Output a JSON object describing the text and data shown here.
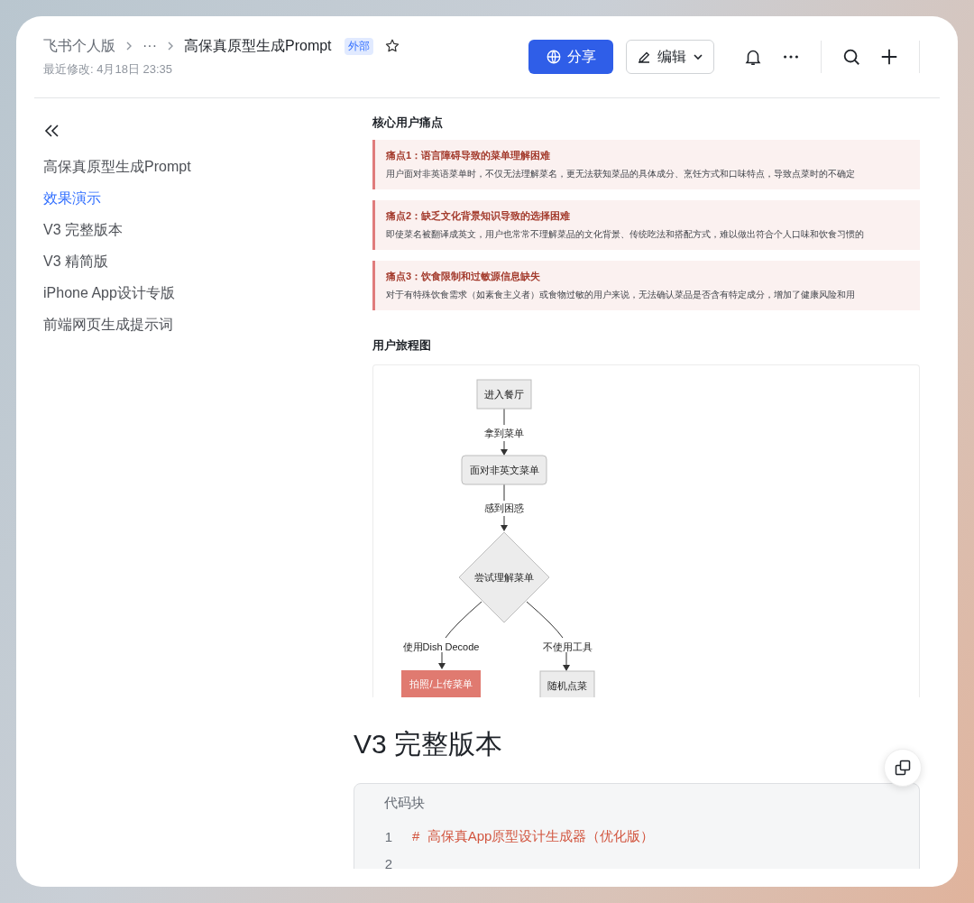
{
  "header": {
    "breadcrumb": [
      "飞书个人版",
      "···",
      "高保真原型生成Prompt"
    ],
    "tag": "外部",
    "modified": "最近修改: 4月18日 23:35",
    "share_button": "分享",
    "edit_button": "编辑"
  },
  "sidebar": {
    "items": [
      {
        "label": "高保真原型生成Prompt",
        "selected": false
      },
      {
        "label": "效果演示",
        "selected": true
      },
      {
        "label": "V3 完整版本",
        "selected": false
      },
      {
        "label": "V3 精简版",
        "selected": false
      },
      {
        "label": "iPhone App设计专版",
        "selected": false
      },
      {
        "label": "前端网页生成提示词",
        "selected": false
      }
    ]
  },
  "pain_points": {
    "title": "核心用户痛点",
    "items": [
      {
        "title": "痛点1：语言障碍导致的菜单理解困难",
        "text": "用户面对非英语菜单时，不仅无法理解菜名，更无法获知菜品的具体成分、烹饪方式和口味特点，导致点菜时的不确定"
      },
      {
        "title": "痛点2：缺乏文化背景知识导致的选择困难",
        "text": "即使菜名被翻译成英文，用户也常常不理解菜品的文化背景、传统吃法和搭配方式，难以做出符合个人口味和饮食习惯的"
      },
      {
        "title": "痛点3：饮食限制和过敏源信息缺失",
        "text": "对于有特殊饮食需求（如素食主义者）或食物过敏的用户来说，无法确认菜品是否含有特定成分，增加了健康风险和用"
      }
    ]
  },
  "journey": {
    "title": "用户旅程图",
    "nodes": [
      {
        "label": "进入餐厅",
        "kind": "rect"
      },
      {
        "label": "面对非英文菜单",
        "kind": "rounded"
      },
      {
        "label": "尝试理解菜单",
        "kind": "diamond"
      },
      {
        "label": "拍照/上传菜单",
        "kind": "highlight"
      },
      {
        "label": "随机点菜",
        "kind": "rect"
      }
    ],
    "edges": [
      {
        "label": "拿到菜单"
      },
      {
        "label": "感到困惑"
      },
      {
        "label": "使用Dish Decode"
      },
      {
        "label": "不使用工具"
      }
    ]
  },
  "section_heading": "V3 完整版本",
  "code_block": {
    "title": "代码块",
    "lines": [
      {
        "number": "1",
        "text": "#  高保真App原型设计生成器（优化版）"
      },
      {
        "number": "2"
      }
    ]
  }
}
